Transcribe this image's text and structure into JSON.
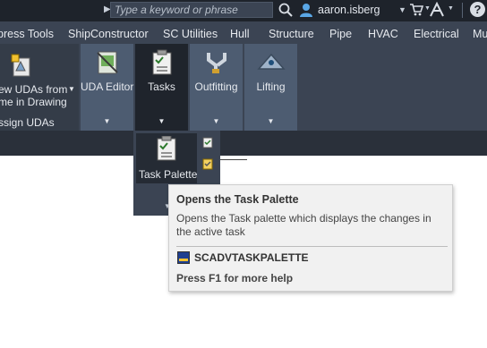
{
  "titlebar": {
    "search_placeholder": "Type a keyword or phrase",
    "username": "aaron.isberg",
    "help_label": "?"
  },
  "ribbon_tabs": [
    "press Tools",
    "ShipConstructor",
    "SC Utilities",
    "Hull",
    "Structure",
    "Pipe",
    "HVAC",
    "Electrical",
    "Mu"
  ],
  "ribbon": {
    "left_button_line1": "ew UDAs from",
    "left_button_line2": "me in Drawing",
    "left_group_label": "ssign UDAs",
    "panels": [
      {
        "label": "UDA Editor",
        "icon": "uda-editor-icon"
      },
      {
        "label": "Tasks",
        "icon": "tasks-icon"
      },
      {
        "label": "Outfitting",
        "icon": "outfitting-icon"
      },
      {
        "label": "Lifting",
        "icon": "lifting-icon"
      }
    ]
  },
  "dropdown": {
    "task_palette_label": "Task Palette"
  },
  "tooltip": {
    "title": "Opens the Task Palette",
    "description": "Opens the Task palette which displays the changes in the active task",
    "command": "SCADVTASKPALETTE",
    "help": "Press F1 for more help"
  },
  "colors": {
    "titlebar_bg": "#1e232b",
    "ribbon_bg": "#3b4453",
    "panel_highlight": "#4d5c71",
    "active_panel": "#1f242c",
    "tooltip_bg": "#f1f1f1"
  }
}
